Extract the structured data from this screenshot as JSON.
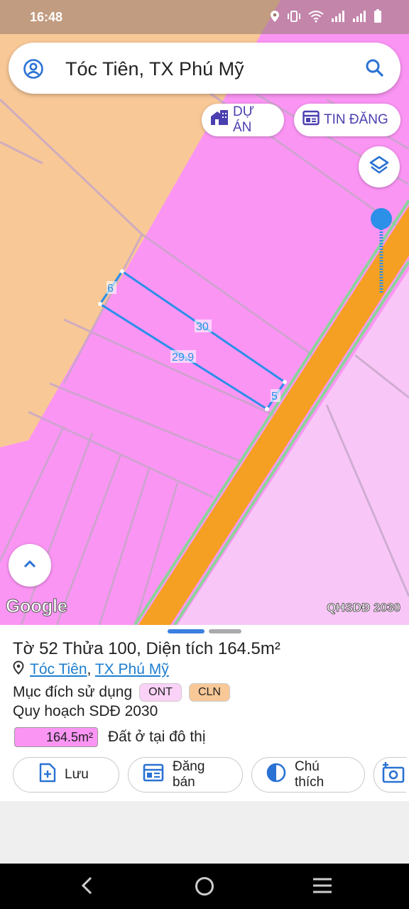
{
  "status_bar": {
    "time": "16:48"
  },
  "search": {
    "query": "Tóc Tiên, TX Phú Mỹ"
  },
  "chips": {
    "du_an": "DỰ ÁN",
    "tin_dang": "TIN ĐĂNG"
  },
  "map": {
    "parcel_labels": {
      "left": "6",
      "top": "30",
      "bottom": "29.9",
      "right": "5"
    },
    "attribution": "Google",
    "layer_name": "QHSDĐ 2030",
    "colors": {
      "residential": "#fb95f4",
      "agri": "#f8c897",
      "road": "#f5a022",
      "road_edge": "#8ad49a",
      "parcel_outline": "#2c8fe8"
    }
  },
  "sheet": {
    "title": "Tờ 52 Thửa 100, Diện tích 164.5m²",
    "location": {
      "commune": "Tóc Tiên",
      "separator": ",",
      "town": "TX Phú Mỹ"
    },
    "purpose_label": "Mục đích sử dụng",
    "tags": [
      "ONT",
      "CLN"
    ],
    "plan_label": "Quy hoạch SDĐ 2030",
    "legend": {
      "area": "164.5m²",
      "label": "Đất ở tại đô thị"
    },
    "actions": {
      "save": "Lưu",
      "post": "Đăng bán",
      "note": "Chú thích"
    }
  }
}
